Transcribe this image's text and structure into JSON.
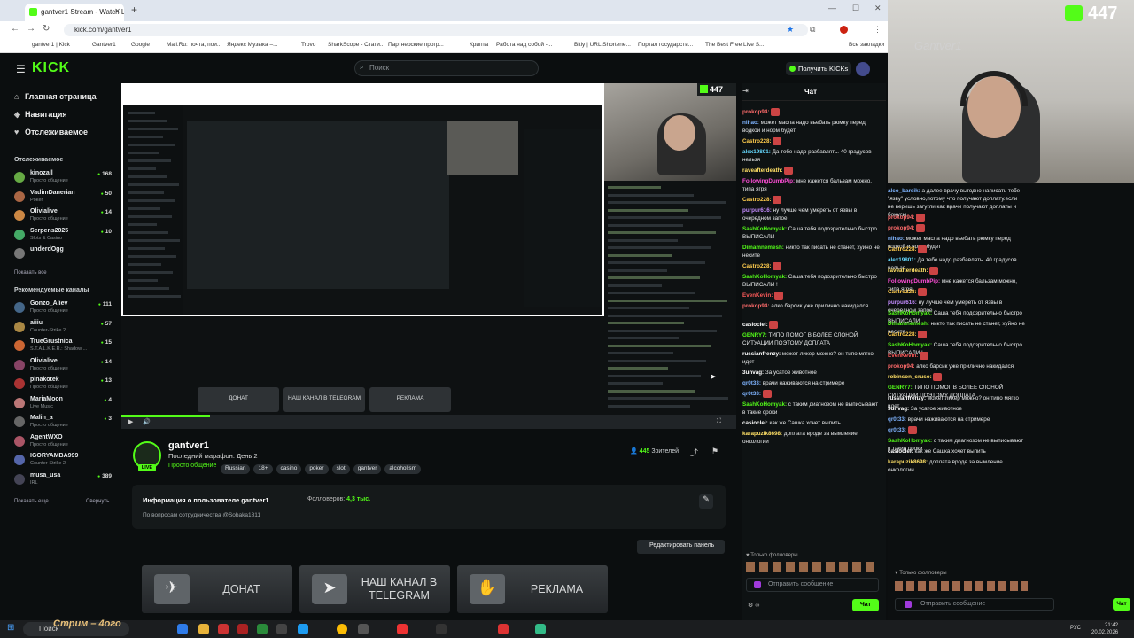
{
  "browser": {
    "tab_title": "gantver1 Stream - Watch Live ...",
    "url": "kick.com/gantver1",
    "bookmarks": [
      "gantver1 | Kick",
      "Gantver1",
      "Google",
      "Mail.Ru: почта, пои...",
      "Яндекс Музыка –...",
      "Trovo",
      "SharkScope - Стати...",
      "Партнерские прогр...",
      "Крипта",
      "Работа над собой -...",
      "Bitly | URL Shortene...",
      "Портал государств...",
      "The Best Free Live S..."
    ],
    "all_bookmarks": "Все закладки"
  },
  "header": {
    "search_placeholder": "Поиск",
    "get_kicks": "Получить KICKs"
  },
  "sidebar": {
    "nav": [
      "Главная страница",
      "Навигация",
      "Отслеживаемое"
    ],
    "followed_title": "Отслеживаемое",
    "followed": [
      {
        "name": "kinozall",
        "sub": "Просто общение",
        "viewers": "168"
      },
      {
        "name": "VadimDanerian",
        "sub": "Poker",
        "viewers": "50"
      },
      {
        "name": "Olivialive",
        "sub": "Просто общение",
        "viewers": "14"
      },
      {
        "name": "Serpens2025",
        "sub": "Slots & Casino",
        "viewers": "10"
      },
      {
        "name": "underdOgg",
        "sub": "",
        "viewers": ""
      }
    ],
    "show_all": "Показать все",
    "rec_title": "Рекомендуемые каналы",
    "recommended": [
      {
        "name": "Gonzo_Aliev",
        "sub": "Просто общение",
        "viewers": "111"
      },
      {
        "name": "aiiiu",
        "sub": "Counter-Strike 2",
        "viewers": "57"
      },
      {
        "name": "TrueGrustnica",
        "sub": "S.T.A.L.K.E.R.: Shadow ...",
        "viewers": "15"
      },
      {
        "name": "Olivialive",
        "sub": "Просто общение",
        "viewers": "14"
      },
      {
        "name": "pinakotek",
        "sub": "Просто общение",
        "viewers": "13"
      },
      {
        "name": "MariaMoon",
        "sub": "Live Music",
        "viewers": "4"
      },
      {
        "name": "Malin_a",
        "sub": "Просто общение",
        "viewers": "3"
      },
      {
        "name": "AgentWXO",
        "sub": "Просто общение",
        "viewers": ""
      },
      {
        "name": "IGORYAMBA999",
        "sub": "Counter-Strike 2",
        "viewers": ""
      },
      {
        "name": "musa_usa",
        "sub": "IRL",
        "viewers": "389"
      }
    ],
    "show_more": "Показать еще",
    "collapse": "Свернуть"
  },
  "video": {
    "viewer_count": "447",
    "buttons": [
      "ДОНАТ",
      "НАШ КАНАЛ В TELEGRAM",
      "РЕКЛАМА"
    ]
  },
  "channel": {
    "name": "gantver1",
    "title": "Последний марафон. День 2",
    "category": "Просто общение",
    "tags": [
      "Russian",
      "18+",
      "casino",
      "poker",
      "slot",
      "gantver",
      "alcoholism"
    ],
    "viewers": "445",
    "viewers_label": "Зрителей",
    "info_title": "Информация о пользователе gantver1",
    "followers_label": "Фолловеров:",
    "followers": "4,3 тыс.",
    "info_desc": "По вопросам сотрудничества @Sobaka1811",
    "edit_panel": "Редактировать панель",
    "panels": [
      {
        "label": "ДОНАТ",
        "icon": "✈"
      },
      {
        "label": "НАШ КАНАЛ В TELEGRAM",
        "icon": "➤"
      },
      {
        "label": "РЕКЛАМА",
        "icon": "🤝"
      }
    ]
  },
  "chat": {
    "title": "Чат",
    "followers_only": "Только фолловеры",
    "input_placeholder": "Отправить сообщение",
    "send": "Чат",
    "messages": [
      {
        "user": "prokop94:",
        "color": "#ff6b6b",
        "text": "",
        "emote": true
      },
      {
        "user": "nihao:",
        "color": "#7fb4ff",
        "text": "может масла надо вьебать рюмку перед водкой и норм будет"
      },
      {
        "user": "Castro228:",
        "color": "#ffcc4d",
        "text": "",
        "emote": true
      },
      {
        "user": "alex19801:",
        "color": "#66d9ff",
        "text": "Да тебе надо разбавлять. 40 градусов нельзя"
      },
      {
        "user": "raveafterdeath:",
        "color": "#ffe066",
        "text": "",
        "emote": true
      },
      {
        "user": "FollowingDumbPip:",
        "color": "#ff4fd8",
        "text": "мне кажется бальзам можно, типа ягря"
      },
      {
        "user": "Castro228:",
        "color": "#ffcc4d",
        "text": "",
        "emote": true
      },
      {
        "user": "purpur616:",
        "color": "#c48cff",
        "text": "ну лучше чем умереть от язвы в очередном запое"
      },
      {
        "user": "SashKoHomyak:",
        "color": "#53fc18",
        "text": "Саша тебя подозрительно быстро ВЫПИСАЛИ"
      },
      {
        "user": "Dimamnemesh:",
        "color": "#53fc18",
        "text": "никто так писать не станет, хуйно не несите"
      },
      {
        "user": "Castro228:",
        "color": "#ffcc4d",
        "text": "",
        "emote": true
      },
      {
        "user": "SashKoHomyak:",
        "color": "#53fc18",
        "text": "Саша тебя подозрительно быстро ВЫПИСАЛИ !"
      },
      {
        "user": "EvenKevin:",
        "color": "#ff5a5a",
        "text": "",
        "emote": true
      },
      {
        "user": "prokop94:",
        "color": "#ff6b6b",
        "text": "алко барсик уже прилично накидался"
      },
      {
        "user": "casioclei:",
        "color": "#ffffff",
        "text": "",
        "emote": true
      },
      {
        "user": "GENRY7:",
        "color": "#53fc18",
        "text": "ТИПО ПОМОГ В БОЛЕЕ СЛОНОЙ СИТУАЦИИ ПОЭТОМУ ДОПЛАТА"
      },
      {
        "user": "russianfrenzy:",
        "color": "#ffffff",
        "text": "может ликер можно? он типо мягко идет"
      },
      {
        "user": "3unvag:",
        "color": "#ffffff",
        "text": "За усатое животное"
      },
      {
        "user": "qr0t33:",
        "color": "#7fb4ff",
        "text": "врачи наживаются на стримере"
      },
      {
        "user": "qr0t33:",
        "color": "#7fb4ff",
        "text": "",
        "emote": true
      },
      {
        "user": "SashKoHomyak:",
        "color": "#53fc18",
        "text": "с таким диагнозом не выписывают в такие сроки"
      },
      {
        "user": "casioclei:",
        "color": "#ffffff",
        "text": "как же Сашка хочет выпить"
      },
      {
        "user": "karapuzik8698:",
        "color": "#ffe066",
        "text": "доплата вроде за вымление онкологии"
      }
    ]
  },
  "overlay": {
    "viewer_count": "447",
    "wall_text": "Gantver1",
    "messages": [
      {
        "user": "alco_barsik:",
        "color": "#7fb4ff",
        "text": "а далее врачу выгодно написать тебе \"язву\" условно,потому что получают доплату.если не веришь загугли как врачи получают доплаты и бонусы"
      },
      {
        "user": "prokop94:",
        "color": "#ff6b6b",
        "text": "",
        "emote": true
      },
      {
        "user": "prokop94:",
        "color": "#ff6b6b",
        "text": "",
        "emote": true
      },
      {
        "user": "nihao:",
        "color": "#7fb4ff",
        "text": "может масла надо вьебать рюмку перед водкой и норм будет"
      },
      {
        "user": "Castro228:",
        "color": "#ffcc4d",
        "text": "",
        "emote": true
      },
      {
        "user": "alex19801:",
        "color": "#66d9ff",
        "text": "Да тебе надо разбавлять. 40 градусов нельзя"
      },
      {
        "user": "raveafterdeath:",
        "color": "#ffe066",
        "text": "",
        "emote": true
      },
      {
        "user": "FollowingDumbPip:",
        "color": "#ff4fd8",
        "text": "мне кажется бальзам можно, типа ягря"
      },
      {
        "user": "Castro228:",
        "color": "#ffcc4d",
        "text": "",
        "emote": true
      },
      {
        "user": "purpur616:",
        "color": "#c48cff",
        "text": "ну лучше чем умереть от язвы в очередном запое"
      },
      {
        "user": "SashKoHomyak:",
        "color": "#53fc18",
        "text": "Саша тебя подозрительно быстро ВЫПИСАЛИ"
      },
      {
        "user": "Dimamnemesh:",
        "color": "#53fc18",
        "text": "никто так писать не станет, хуйно не несите"
      },
      {
        "user": "Castro228:",
        "color": "#ffcc4d",
        "text": "",
        "emote": true
      },
      {
        "user": "SashKoHomyak:",
        "color": "#53fc18",
        "text": "Саша тебя подозрительно быстро ВЫПИСАЛИ !"
      },
      {
        "user": "EvenKevin:",
        "color": "#ff5a5a",
        "text": "",
        "emote": true
      },
      {
        "user": "prokop94:",
        "color": "#ff6b6b",
        "text": "алко барсик уже прилично накидался"
      },
      {
        "user": "robinson_cruso:",
        "color": "#ffe066",
        "text": "",
        "emote": true
      },
      {
        "user": "GENRY7:",
        "color": "#53fc18",
        "text": "ТИПО ПОМОГ В БОЛЕЕ СЛОНОЙ СИТУАЦИИ ПОЭТОМУ ДОПЛАТА"
      },
      {
        "user": "russianfrenzy:",
        "color": "#ffffff",
        "text": "может ликер можно? он типо мягко идет"
      },
      {
        "user": "3unvag:",
        "color": "#ffffff",
        "text": "За усатое животное"
      },
      {
        "user": "qr0t33:",
        "color": "#7fb4ff",
        "text": "врачи наживаются на стримере"
      },
      {
        "user": "qr0t33:",
        "color": "#7fb4ff",
        "text": "",
        "emote": true
      },
      {
        "user": "SashKoHomyak:",
        "color": "#53fc18",
        "text": "с таким диагнозом не выписывают в такие сроки"
      },
      {
        "user": "casioclei:",
        "color": "#ffffff",
        "text": "как же Сашка хочет выпить"
      },
      {
        "user": "karapuzik8698:",
        "color": "#ffe066",
        "text": "доплата вроде за вымление онкологии"
      }
    ],
    "followers_only": "Только фолловеры",
    "input_placeholder": "Отправить сообщение",
    "send": "Чат"
  },
  "taskbar": {
    "search": "Поиск",
    "time": "21:42",
    "date": "20.02.2026",
    "lang": "РУС"
  },
  "watermark": "Стрим – 4ого"
}
